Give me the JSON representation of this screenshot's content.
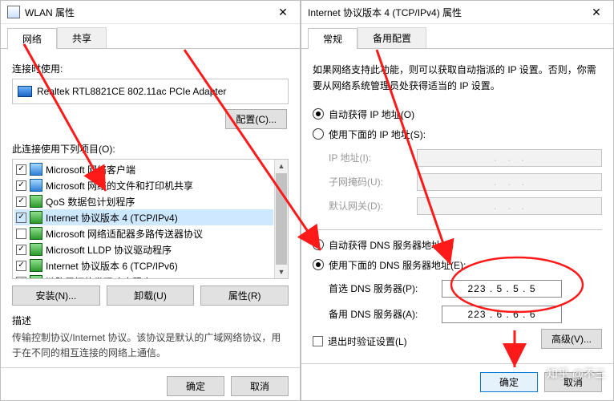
{
  "left": {
    "title": "WLAN 属性",
    "tabs": {
      "network": "网络",
      "share": "共享"
    },
    "connect_using_label": "连接时使用:",
    "adapter": "Realtek RTL8821CE 802.11ac PCIe Adapter",
    "configure_btn": "配置(C)...",
    "items_label": "此连接使用下列项目(O):",
    "items": [
      {
        "checked": true,
        "icon": "blue",
        "text": "Microsoft 网络客户端"
      },
      {
        "checked": true,
        "icon": "blue",
        "text": "Microsoft 网络的文件和打印机共享"
      },
      {
        "checked": true,
        "icon": "green",
        "text": "QoS 数据包计划程序"
      },
      {
        "checked": true,
        "icon": "green",
        "text": "Internet 协议版本 4 (TCP/IPv4)",
        "selected": true
      },
      {
        "checked": false,
        "icon": "green",
        "text": "Microsoft 网络适配器多路传送器协议"
      },
      {
        "checked": true,
        "icon": "green",
        "text": "Microsoft LLDP 协议驱动程序"
      },
      {
        "checked": true,
        "icon": "green",
        "text": "Internet 协议版本 6 (TCP/IPv6)"
      },
      {
        "checked": true,
        "icon": "green",
        "text": "链路层拓扑发现响应程序"
      }
    ],
    "install_btn": "安装(N)...",
    "uninstall_btn": "卸载(U)",
    "properties_btn": "属性(R)",
    "desc_title": "描述",
    "desc_text": "传输控制协议/Internet 协议。该协议是默认的广域网络协议，用于在不同的相互连接的网络上通信。",
    "ok": "确定",
    "cancel": "取消"
  },
  "right": {
    "title": "Internet 协议版本 4 (TCP/IPv4) 属性",
    "tabs": {
      "general": "常规",
      "alt": "备用配置"
    },
    "intro": "如果网络支持此功能，则可以获取自动指派的 IP 设置。否则，你需要从网络系统管理员处获得适当的 IP 设置。",
    "ip_auto": "自动获得 IP 地址(O)",
    "ip_manual": "使用下面的 IP 地址(S):",
    "ip_label": "IP 地址(I):",
    "mask_label": "子网掩码(U):",
    "gw_label": "默认网关(D):",
    "dns_auto": "自动获得 DNS 服务器地址(B)",
    "dns_manual": "使用下面的 DNS 服务器地址(E):",
    "dns1_label": "首选 DNS 服务器(P):",
    "dns2_label": "备用 DNS 服务器(A):",
    "dns1_value": "223 .  5  .  5  .  5",
    "dns2_value": "223 .  6  .  6  .  6",
    "validate": "退出时验证设置(L)",
    "advanced": "高级(V)...",
    "ok": "确定",
    "cancel": "取消"
  },
  "watermark": "知乎 @不三"
}
